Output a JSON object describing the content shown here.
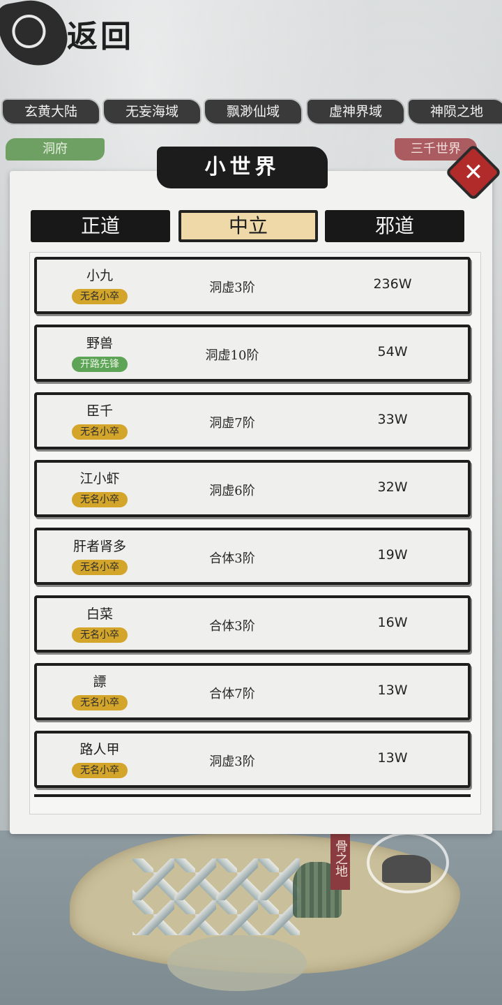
{
  "logo": {
    "text": "返回"
  },
  "regions": [
    "玄黄大陆",
    "无妄海域",
    "飘渺仙域",
    "虚神界域",
    "神陨之地"
  ],
  "side_left": "洞府",
  "side_right": "三千世界",
  "dialog": {
    "title": "小世界",
    "close_label": "✕"
  },
  "factions": [
    {
      "label": "正道",
      "active": false
    },
    {
      "label": "中立",
      "active": true
    },
    {
      "label": "邪道",
      "active": false
    }
  ],
  "players": [
    {
      "name": "小九",
      "badge": "无名小卒",
      "badge_color": "#d3a52a",
      "realm": "洞虚3阶",
      "power": "236W"
    },
    {
      "name": "野兽",
      "badge": "开路先锋",
      "badge_color": "#5ea457",
      "realm": "洞虚10阶",
      "power": "54W"
    },
    {
      "name": "臣千",
      "badge": "无名小卒",
      "badge_color": "#d3a52a",
      "realm": "洞虚7阶",
      "power": "33W"
    },
    {
      "name": "江小虾",
      "badge": "无名小卒",
      "badge_color": "#d3a52a",
      "realm": "洞虚6阶",
      "power": "32W"
    },
    {
      "name": "肝者肾多",
      "badge": "无名小卒",
      "badge_color": "#d3a52a",
      "realm": "合体3阶",
      "power": "19W"
    },
    {
      "name": "白菜",
      "badge": "无名小卒",
      "badge_color": "#d3a52a",
      "realm": "合体3阶",
      "power": "16W"
    },
    {
      "name": "謤",
      "badge": "无名小卒",
      "badge_color": "#d3a52a",
      "realm": "合体7阶",
      "power": "13W"
    },
    {
      "name": "路人甲",
      "badge": "无名小卒",
      "badge_color": "#d3a52a",
      "realm": "洞虚3阶",
      "power": "13W"
    }
  ],
  "map_label": "骨之地"
}
